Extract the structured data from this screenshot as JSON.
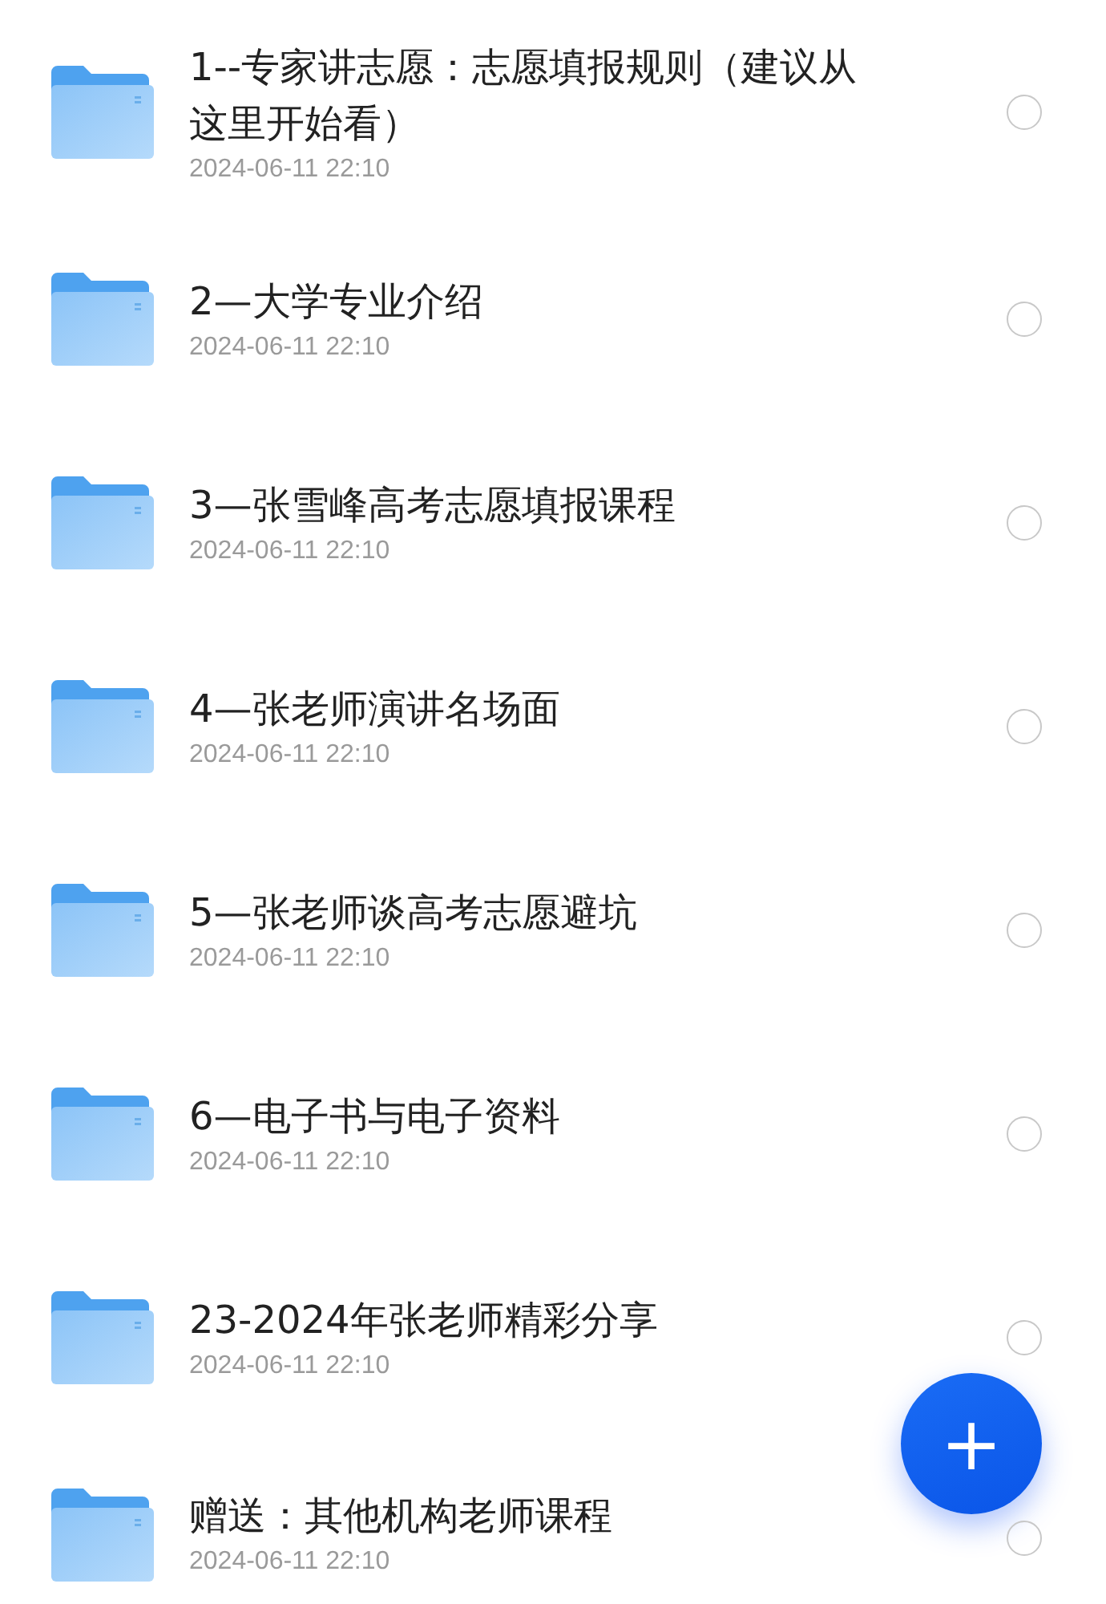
{
  "files": [
    {
      "title": "1--专家讲志愿：志愿填报规则（建议从这里开始看）",
      "date": "2024-06-11 22:10",
      "selected": false
    },
    {
      "title": "2—大学专业介绍",
      "date": "2024-06-11 22:10",
      "selected": false
    },
    {
      "title": "3—张雪峰高考志愿填报课程",
      "date": "2024-06-11 22:10",
      "selected": false
    },
    {
      "title": "4—张老师演讲名场面",
      "date": "2024-06-11 22:10",
      "selected": false
    },
    {
      "title": "5—张老师谈高考志愿避坑",
      "date": "2024-06-11 22:10",
      "selected": false
    },
    {
      "title": "6—电子书与电子资料",
      "date": "2024-06-11 22:10",
      "selected": false
    },
    {
      "title": "23-2024年张老师精彩分享",
      "date": "2024-06-11 22:10",
      "selected": false
    },
    {
      "title": "赠送：其他机构老师课程",
      "date": "2024-06-11 22:10",
      "selected": false
    }
  ],
  "fab": {
    "label": "+"
  }
}
